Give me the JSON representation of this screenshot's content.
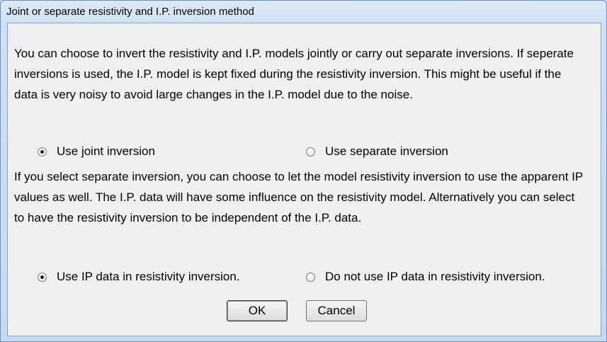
{
  "window": {
    "title": "Joint or separate resistivity and I.P. inversion method"
  },
  "paragraph1": "You can choose to invert the resistivity and I.P. models jointly or carry out separate inversions. If seperate inversions is used, the I.P. model is kept fixed during the resistivity inversion. This might be useful if the data is very noisy to avoid large changes in the I.P. model due to the noise.",
  "inversion_mode": {
    "options": [
      {
        "label": "Use joint inversion",
        "checked": true
      },
      {
        "label": "Use separate inversion",
        "checked": false
      }
    ]
  },
  "paragraph2": "If you select separate inversion, you can choose to let the model resistivity inversion to use the apparent IP values as well. The I.P. data will have some influence on the resistivity model. Alternatively you can select to have the resistivity inversion to be independent of the I.P. data.",
  "ip_usage": {
    "options": [
      {
        "label": "Use IP data in resistivity inversion.",
        "checked": true
      },
      {
        "label": "Do not use IP data in resistivity inversion.",
        "checked": false
      }
    ]
  },
  "buttons": {
    "ok": "OK",
    "cancel": "Cancel"
  }
}
